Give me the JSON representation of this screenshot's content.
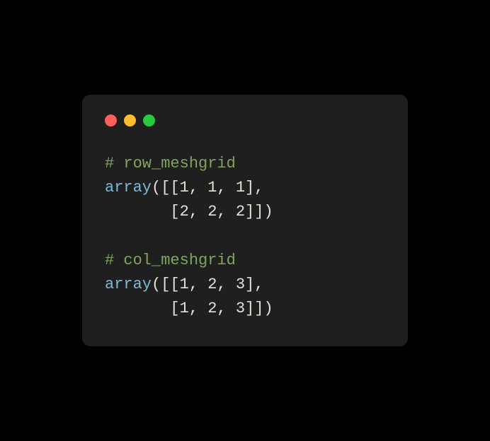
{
  "window": {
    "dots": [
      "red",
      "yellow",
      "green"
    ]
  },
  "code": {
    "line1_comment": "# row_meshgrid",
    "line2_func": "array",
    "line2_rest": "([[1, 1, 1],",
    "line3_indent": "       ",
    "line3_rest": "[2, 2, 2]])",
    "line4_comment": "# col_meshgrid",
    "line5_func": "array",
    "line5_rest": "([[1, 2, 3],",
    "line6_indent": "       ",
    "line6_rest": "[1, 2, 3]])"
  },
  "colors": {
    "bg": "#000000",
    "window_bg": "#1f1f1f",
    "comment": "#7fa65a",
    "func": "#7db9d6",
    "text": "#e6e2d8",
    "red": "#ff5f56",
    "yellow": "#ffbd2e",
    "green": "#27c93f"
  }
}
